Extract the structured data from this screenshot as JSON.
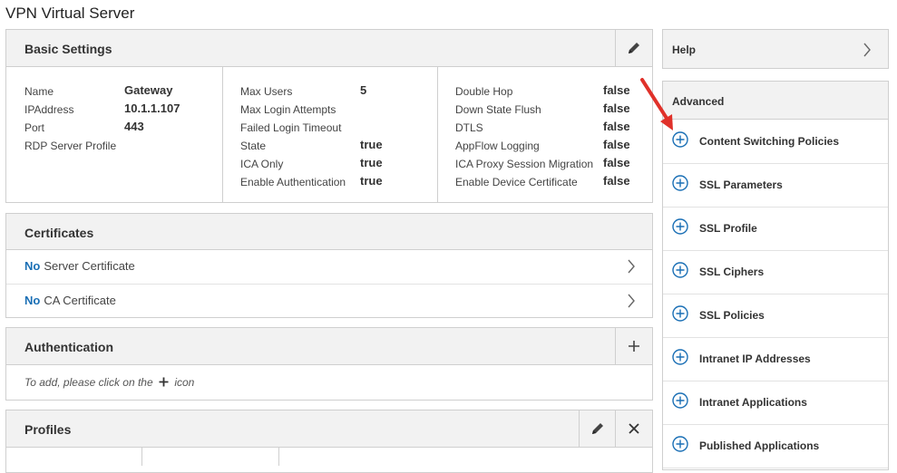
{
  "page": {
    "title": "VPN Virtual Server"
  },
  "basic_settings": {
    "title": "Basic Settings",
    "col1": [
      {
        "label": "Name",
        "value": "Gateway"
      },
      {
        "label": "IPAddress",
        "value": "10.1.1.107"
      },
      {
        "label": "Port",
        "value": "443"
      },
      {
        "label": "RDP Server Profile",
        "value": ""
      }
    ],
    "col2": [
      {
        "label": "Max Users",
        "value": "5"
      },
      {
        "label": "Max Login Attempts",
        "value": ""
      },
      {
        "label": "Failed Login Timeout",
        "value": ""
      },
      {
        "label": "State",
        "value": "true"
      },
      {
        "label": "ICA Only",
        "value": "true"
      },
      {
        "label": "Enable Authentication",
        "value": "true"
      }
    ],
    "col3": [
      {
        "label": "Double Hop",
        "value": "false"
      },
      {
        "label": "Down State Flush",
        "value": "false"
      },
      {
        "label": "DTLS",
        "value": "false"
      },
      {
        "label": "AppFlow Logging",
        "value": "false"
      },
      {
        "label": "ICA Proxy Session Migration",
        "value": "false"
      },
      {
        "label": "Enable Device Certificate",
        "value": "false"
      }
    ]
  },
  "certificates": {
    "title": "Certificates",
    "rows": [
      {
        "prefix": "No",
        "label": "Server Certificate"
      },
      {
        "prefix": "No",
        "label": "CA Certificate"
      }
    ]
  },
  "authentication": {
    "title": "Authentication",
    "hint_prefix": "To add, please click on the",
    "hint_suffix": "icon"
  },
  "profiles": {
    "title": "Profiles"
  },
  "help": {
    "title": "Help"
  },
  "advanced": {
    "title": "Advanced",
    "items": [
      "Content Switching Policies",
      "SSL Parameters",
      "SSL Profile",
      "SSL Ciphers",
      "SSL Policies",
      "Intranet IP Addresses",
      "Intranet Applications",
      "Published Applications"
    ]
  },
  "colors": {
    "accent": "#1a6fb5",
    "arrow": "#e0312a",
    "header_bg": "#f2f2f2"
  }
}
